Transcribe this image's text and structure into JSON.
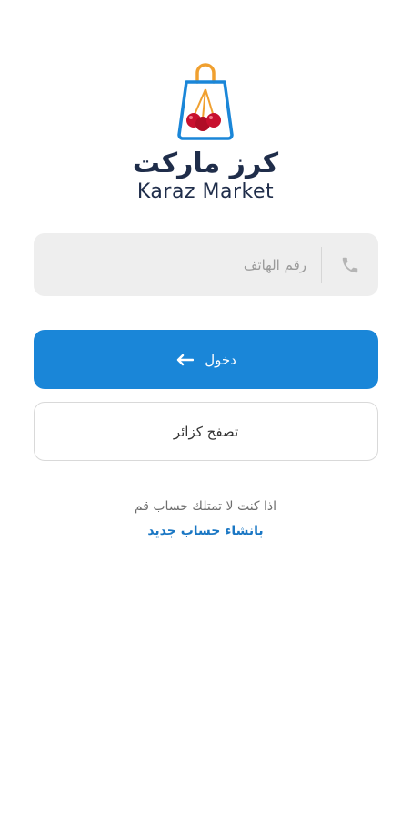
{
  "brand": {
    "name_ar": "كرز ماركت",
    "name_en": "Karaz Market"
  },
  "phone_field": {
    "placeholder": "رقم الهاتف",
    "icon": "phone-icon"
  },
  "login_button": {
    "label": "دخول",
    "icon": "arrow-left-icon"
  },
  "browse_button": {
    "label": "تصفح كزائر"
  },
  "signup": {
    "prompt": "اذا كنت لا تمتلك حساب قم",
    "link_label": "بانشاء حساب جديد"
  },
  "colors": {
    "primary": "#1a86d8",
    "link": "#1a77c4",
    "brand_text": "#1f2d4a",
    "cherry": "#c8102e",
    "bag": "#1a86d8",
    "handle": "#f0a030"
  }
}
